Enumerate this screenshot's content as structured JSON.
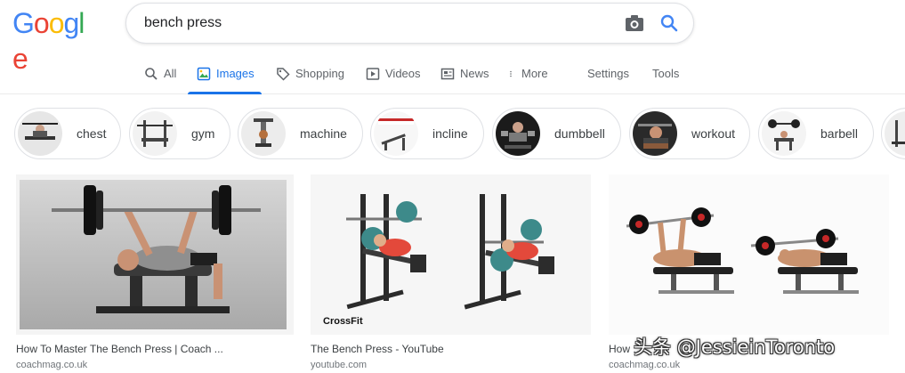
{
  "logo": {
    "text": "Google"
  },
  "search": {
    "query": "bench press"
  },
  "tabs": {
    "all": "All",
    "images": "Images",
    "shopping": "Shopping",
    "videos": "Videos",
    "news": "News",
    "more": "More",
    "settings": "Settings",
    "tools": "Tools"
  },
  "chips": [
    "chest",
    "gym",
    "machine",
    "incline",
    "dumbbell",
    "workout",
    "barbell"
  ],
  "results": [
    {
      "title": "How To Master The Bench Press | Coach ...",
      "source": "coachmag.co.uk"
    },
    {
      "title": "The Bench Press - YouTube",
      "source": "youtube.com",
      "image_text": "CrossFit"
    },
    {
      "title": "How ...",
      "source": "coachmag.co.uk"
    }
  ],
  "watermark": "头条 @JessieinToronto",
  "colors": {
    "accent": "#1a73e8",
    "logo_blue": "#4285f4",
    "logo_red": "#ea4335",
    "logo_yellow": "#fbbc05",
    "logo_green": "#34a853"
  }
}
